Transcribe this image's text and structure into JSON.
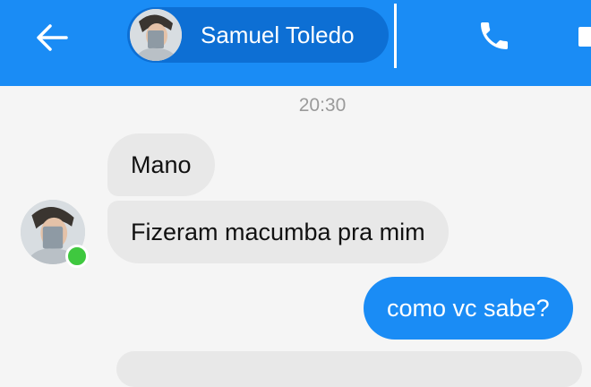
{
  "header": {
    "contact_name": "Samuel Toledo",
    "icons": {
      "back": "back-arrow-icon",
      "call": "phone-icon",
      "video": "video-camera-icon"
    },
    "colors": {
      "bar": "#1a8cf5",
      "pill": "#0d6fd4"
    }
  },
  "conversation": {
    "timestamp": "20:30",
    "messages": [
      {
        "from": "contact",
        "text": "Mano"
      },
      {
        "from": "contact",
        "text": "Fizeram macumba pra mim"
      },
      {
        "from": "me",
        "text": "como vc sabe?"
      }
    ],
    "contact_online": true,
    "colors": {
      "incoming_bubble": "#e8e8e8",
      "outgoing_bubble": "#1a8cf5",
      "online_dot": "#3fc83f"
    }
  }
}
